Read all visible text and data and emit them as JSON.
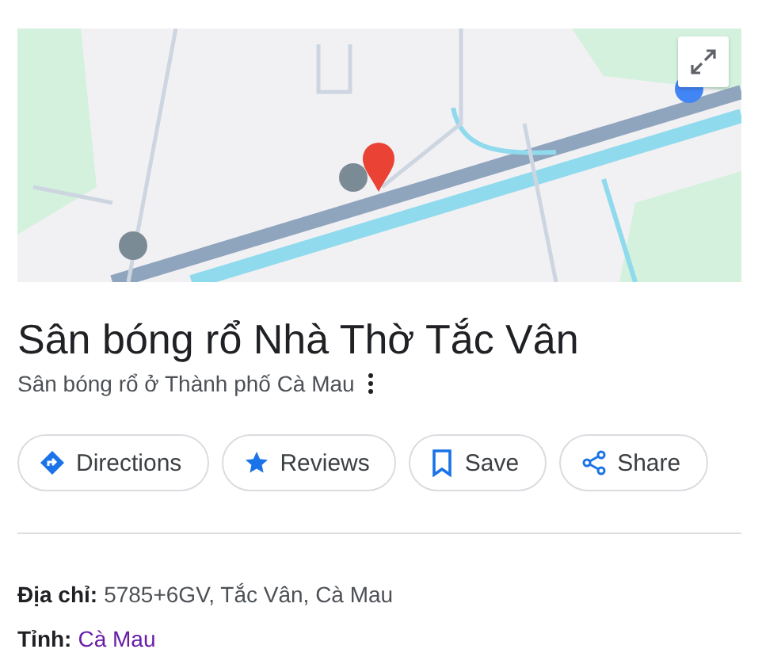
{
  "title": "Sân bóng rổ Nhà Thờ Tắc Vân",
  "subtitle": "Sân bóng rổ ở Thành phố Cà Mau",
  "actions": [
    {
      "label": "Directions"
    },
    {
      "label": "Reviews"
    },
    {
      "label": "Save"
    },
    {
      "label": "Share"
    }
  ],
  "details": [
    {
      "label": "Địa chỉ:",
      "value": "5785+6GV, Tắc Vân, Cà Mau",
      "kind": "text"
    },
    {
      "label": "Tỉnh:",
      "value": "Cà Mau",
      "kind": "link"
    }
  ]
}
